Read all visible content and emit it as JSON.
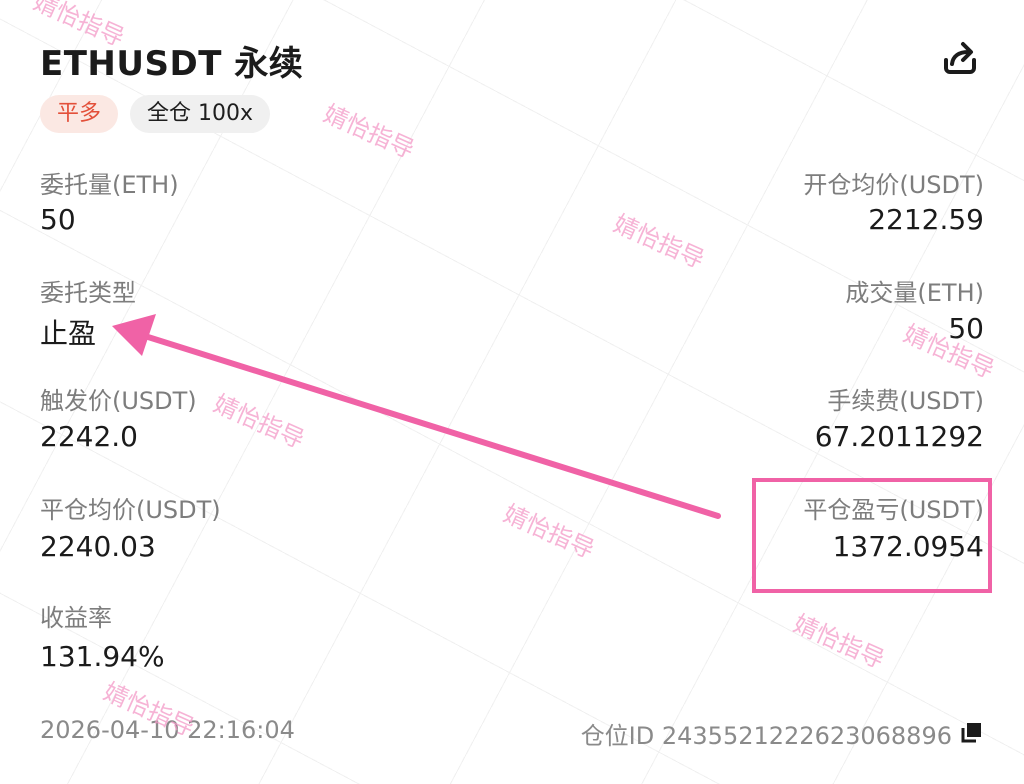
{
  "header": {
    "title": "ETHUSDT 永续",
    "share_icon": "share-icon"
  },
  "badges": {
    "side": "平多",
    "margin": "全仓 100x"
  },
  "left": [
    {
      "label": "委托量(ETH)",
      "value": "50"
    },
    {
      "label": "委托类型",
      "value": "止盈"
    },
    {
      "label": "触发价(USDT)",
      "value": "2242.0"
    },
    {
      "label": "平仓均价(USDT)",
      "value": "2240.03"
    },
    {
      "label": "收益率",
      "value": "131.94%"
    }
  ],
  "right": [
    {
      "label": "开仓均价(USDT)",
      "value": "2212.59"
    },
    {
      "label": "成交量(ETH)",
      "value": "50"
    },
    {
      "label": "手续费(USDT)",
      "value": "67.2011292"
    },
    {
      "label": "平仓盈亏(USDT)",
      "value": "1372.0954"
    }
  ],
  "footer": {
    "timestamp": "2026-04-10 22:16:04",
    "position_id": "仓位ID 2435521222623068896",
    "copy_icon": "copy-icon"
  },
  "watermark_text": "婧怡指导",
  "colors": {
    "side_badge_text": "#e3503a",
    "annotation": "#f062a6"
  }
}
